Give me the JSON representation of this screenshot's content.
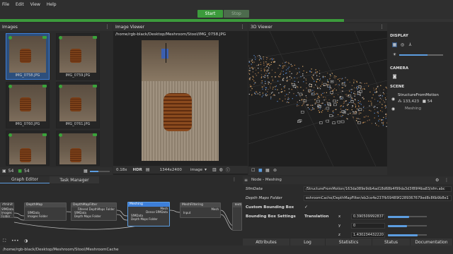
{
  "menu": [
    "File",
    "Edit",
    "View",
    "Help"
  ],
  "toolbar": {
    "start_label": "Start",
    "stop_label": "Stop"
  },
  "progress": {
    "fraction": 0.76
  },
  "images_panel": {
    "title": "Images",
    "thumbs": [
      {
        "label": "IMG_0758.JPG"
      },
      {
        "label": "IMG_0759.JPG"
      },
      {
        "label": "IMG_0760.JPG"
      },
      {
        "label": "IMG_0761.JPG"
      },
      {
        "label": ""
      },
      {
        "label": ""
      }
    ],
    "footer_count_a": "54",
    "footer_count_b": "54"
  },
  "image_viewer": {
    "title": "Image Viewer",
    "path": "/home/rgb-black/Desktop/Meshroom/Stool/IMG_0758.JPG",
    "zoom": "0.18x",
    "hdr": "HDR",
    "resolution": "1344x2400",
    "mode": "image"
  },
  "viewer3d": {
    "title": "3D Viewer"
  },
  "display_panel": {
    "display_label": "DISPLAY",
    "camera_label": "CAMERA",
    "scene_label": "SCENE",
    "scene_item1": "StructureFromMotion",
    "scene_item1_points": "133,423",
    "scene_item1_cams": "54",
    "scene_item2": "Meshing"
  },
  "graph_tabs": {
    "graph_editor": "Graph Editor",
    "task_manager": "Task Manager"
  },
  "nodes": {
    "prepare": "rfmInit",
    "depthmap": "DepthMap",
    "depthmapfilter": "DepthMapFilter",
    "meshing": "Meshing",
    "meshfiltering": "MeshFiltering",
    "texturing": "Texturi",
    "dm_in1": "SfMData",
    "dm_in2": "Images Folder",
    "dmf_out": "Filtered DepthMaps Folder",
    "dmf_in1": "SfMData",
    "dmf_in2": "Depth Maps Folder",
    "m_out1": "Mesh",
    "m_out2": "Dense SfMData",
    "m_in1": "SfMData",
    "m_in2": "Depth Maps Folder",
    "mf_in": "Input",
    "pre_out": "SfMData",
    "pre_out2": "Images Folder"
  },
  "node_panel": {
    "title": "Node - Meshing",
    "sfmdata_label": "SfmData",
    "sfmdata_value": "/StructureFromMotion/163da089e9db4ad18d68b4f99da3d3f89f4ba83/sfm.abc",
    "depthmaps_label": "Depth Maps Folder",
    "depthmaps_value": "eshroomCache/DepthMapFilter/eb2ce4e237fb59489f2289367679ed8c86b9b8e1",
    "custom_bbox_label": "Custom Bounding Box",
    "custom_bbox_value": "✓",
    "bbox_settings_label": "Bounding Box Settings",
    "translation_label": "Translation",
    "x_label": "x",
    "x_value": "0.390509992837",
    "y_label": "y",
    "y_value": "0",
    "z_label": "z",
    "z_value": "1.430234432220"
  },
  "bottom_tabs": [
    "Attributes",
    "Log",
    "Statistics",
    "Status",
    "Documentation"
  ],
  "status_path": "/home/rgb-black/Desktop/Meshroom/Stool/MeshroomCache",
  "colors": {
    "accent": "#3c9b3c",
    "select": "#3d7fd9",
    "meshing_node": "#3d7fd9"
  }
}
